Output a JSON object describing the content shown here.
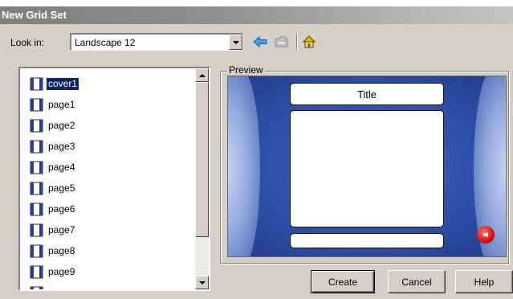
{
  "window": {
    "title": "New Grid Set"
  },
  "lookin": {
    "label": "Look in:",
    "value": "Landscape 12"
  },
  "toolbar": {
    "icons": [
      "back-arrow-icon",
      "folder-icon",
      "home-icon"
    ]
  },
  "list": {
    "selected_index": 0,
    "items": [
      {
        "label": "cover1"
      },
      {
        "label": "page1"
      },
      {
        "label": "page2"
      },
      {
        "label": "page3"
      },
      {
        "label": "page4"
      },
      {
        "label": "page5"
      },
      {
        "label": "page6"
      },
      {
        "label": "page7"
      },
      {
        "label": "page8"
      },
      {
        "label": "page9"
      }
    ]
  },
  "preview": {
    "legend": "Preview",
    "title_cell": "Title",
    "colors": {
      "background": "#2e4ea6",
      "badge": "#d40000"
    }
  },
  "buttons": {
    "create": "Create",
    "cancel": "Cancel",
    "help": "Help"
  },
  "colors": {
    "selection": "#0a246a",
    "face": "#d4d0c8"
  }
}
